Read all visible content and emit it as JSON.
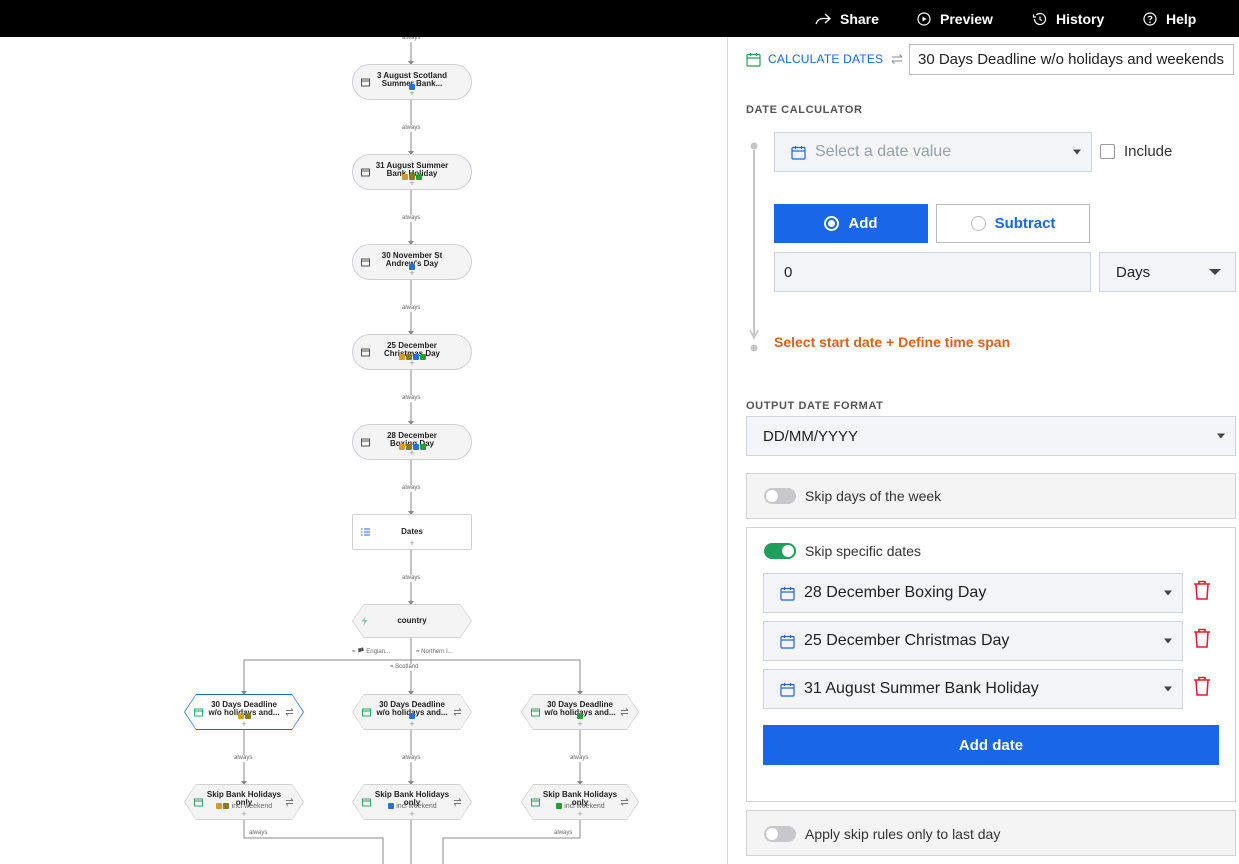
{
  "topbar": {
    "share": "Share",
    "preview": "Preview",
    "history": "History",
    "help": "Help"
  },
  "flow": {
    "edge_label": "always",
    "nodes": {
      "aug3_title": "3 August Scotland Summer Bank...",
      "aug31_title": "31 August Summer Bank Holiday",
      "nov30_title": "30 November St Andrew's Day",
      "dec25_title": "25 December Christmas Day",
      "dec28_title": "28 December Boxing Day",
      "dates_title": "Dates",
      "country_title": "country",
      "deadline1_title": "30 Days Deadline w/o holidays and...",
      "deadline2_title": "30 Days Deadline w/o holidays and...",
      "deadline3_title": "30 Days Deadline w/o holidays and...",
      "skip1_title": "Skip Bank Holidays only",
      "skip1_sub": "incl weekend",
      "skip2_title": "Skip Bank Holidays only",
      "skip2_sub": "incl weekend",
      "skip3_title": "Skip Bank Holidays only",
      "skip3_sub": "incl weekend"
    },
    "branches": {
      "england": "= 🏴 Englan...",
      "northern": "= Northern I...",
      "scotland": "= Scotland"
    }
  },
  "panel": {
    "header_label": "CALCULATE DATES",
    "header_input": "30 Days Deadline w/o holidays and weekends",
    "date_calculator_label": "DATE CALCULATOR",
    "date_select_placeholder": "Select a date value",
    "include_label": "Include",
    "add_label": "Add",
    "subtract_label": "Subtract",
    "amount_value": "0",
    "unit_value": "Days",
    "hint": "Select start date + Define time span",
    "output_format_label": "OUTPUT DATE FORMAT",
    "output_format_value": "DD/MM/YYYY",
    "skip_days_label": "Skip days of the week",
    "skip_specific_label": "Skip specific dates",
    "skip_dates": [
      "28 December Boxing Day",
      "25 December Christmas Day",
      "31 August Summer Bank Holiday"
    ],
    "add_date_label": "Add date",
    "apply_last_label": "Apply skip rules only to last day",
    "colors": {
      "primary": "#1a66e8",
      "hint": "#d9621c",
      "toggle_on": "#1e9e5a",
      "trash": "#e0202c"
    }
  }
}
